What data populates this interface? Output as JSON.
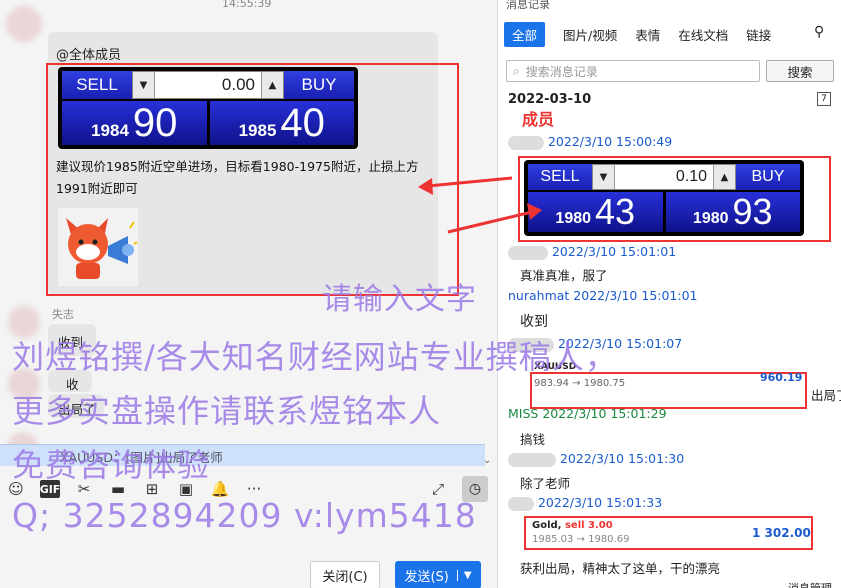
{
  "chat": {
    "timestamp": "14:55:39",
    "mention": "@全体成员",
    "widget1": {
      "sell": "SELL",
      "buy": "BUY",
      "qty": "0.00",
      "sell_small": "1984",
      "sell_big": "90",
      "buy_small": "1985",
      "buy_big": "40"
    },
    "advice_line1": "建议现价1985附近空单进场，目标看1980-1975附近，止损上方",
    "advice_line2": "1991附近即可",
    "reply_name": "失志",
    "reply1": "收到",
    "reply2": "收",
    "reply3": "出局了",
    "preview": "XAUUSD：[图片]出局了老师",
    "toolbar": {
      "emoji": "☺",
      "gif": "GIF",
      "scissors": "✂",
      "folder": "▬",
      "fp": "⊞",
      "image": "▣",
      "bell": "🔔",
      "more": "···"
    },
    "close_label": "关闭(C)",
    "send_label": "发送(S)"
  },
  "history": {
    "title": "消息记录",
    "tabs": [
      "全部",
      "图片/视频",
      "表情",
      "在线文档",
      "链接"
    ],
    "search_placeholder": "搜索消息记录",
    "search_button": "搜索",
    "date": "2022-03-10",
    "title_fragment": "成员",
    "m1_time": "2022/3/10 15:00:49",
    "widget2": {
      "sell": "SELL",
      "buy": "BUY",
      "qty": "0.10",
      "sell_small": "1980",
      "sell_big": "43",
      "buy_small": "1980",
      "buy_big": "93"
    },
    "m2_time": "2022/3/10 15:01:01",
    "m2_text": "真准真准，服了",
    "m3_name": "nurahmat",
    "m3_time": "2022/3/10 15:01:01",
    "m3_text": "收到",
    "m4_time": "2022/3/10 15:01:07",
    "m4_symbol": "XAUUSD",
    "m4_trade": "983.94 → 1980.75",
    "m4_profit": "960.19",
    "m4_tail": "出局了",
    "m5_name": "MISS",
    "m5_time": "2022/3/10 15:01:29",
    "m5_text": "搞钱",
    "m6_time": "2022/3/10 15:01:30",
    "m6_text": "除了老师",
    "m7_time": "2022/3/10 15:01:33",
    "m7_symbol": "Gold,",
    "m7_action": "sell 3.00",
    "m7_trade": "1985.03 → 1980.69",
    "m7_profit": "1 302.00",
    "m8_text": "获利出局，精神太了这单，干的漂亮",
    "footer": "消息管理"
  },
  "watermark": {
    "w1": "请输入文字",
    "w2": "刘煜铭撰/各大知名财经网站专业撰稿人，",
    "w3": "更多实盘操作请联系煜铭本人",
    "w4": "免费咨询体验",
    "w5": "Q; 3252894209  v:lym5418"
  },
  "colors": {
    "accent": "#1a73e8",
    "highlight": "#e33333",
    "watermark": "#9b79e6"
  }
}
